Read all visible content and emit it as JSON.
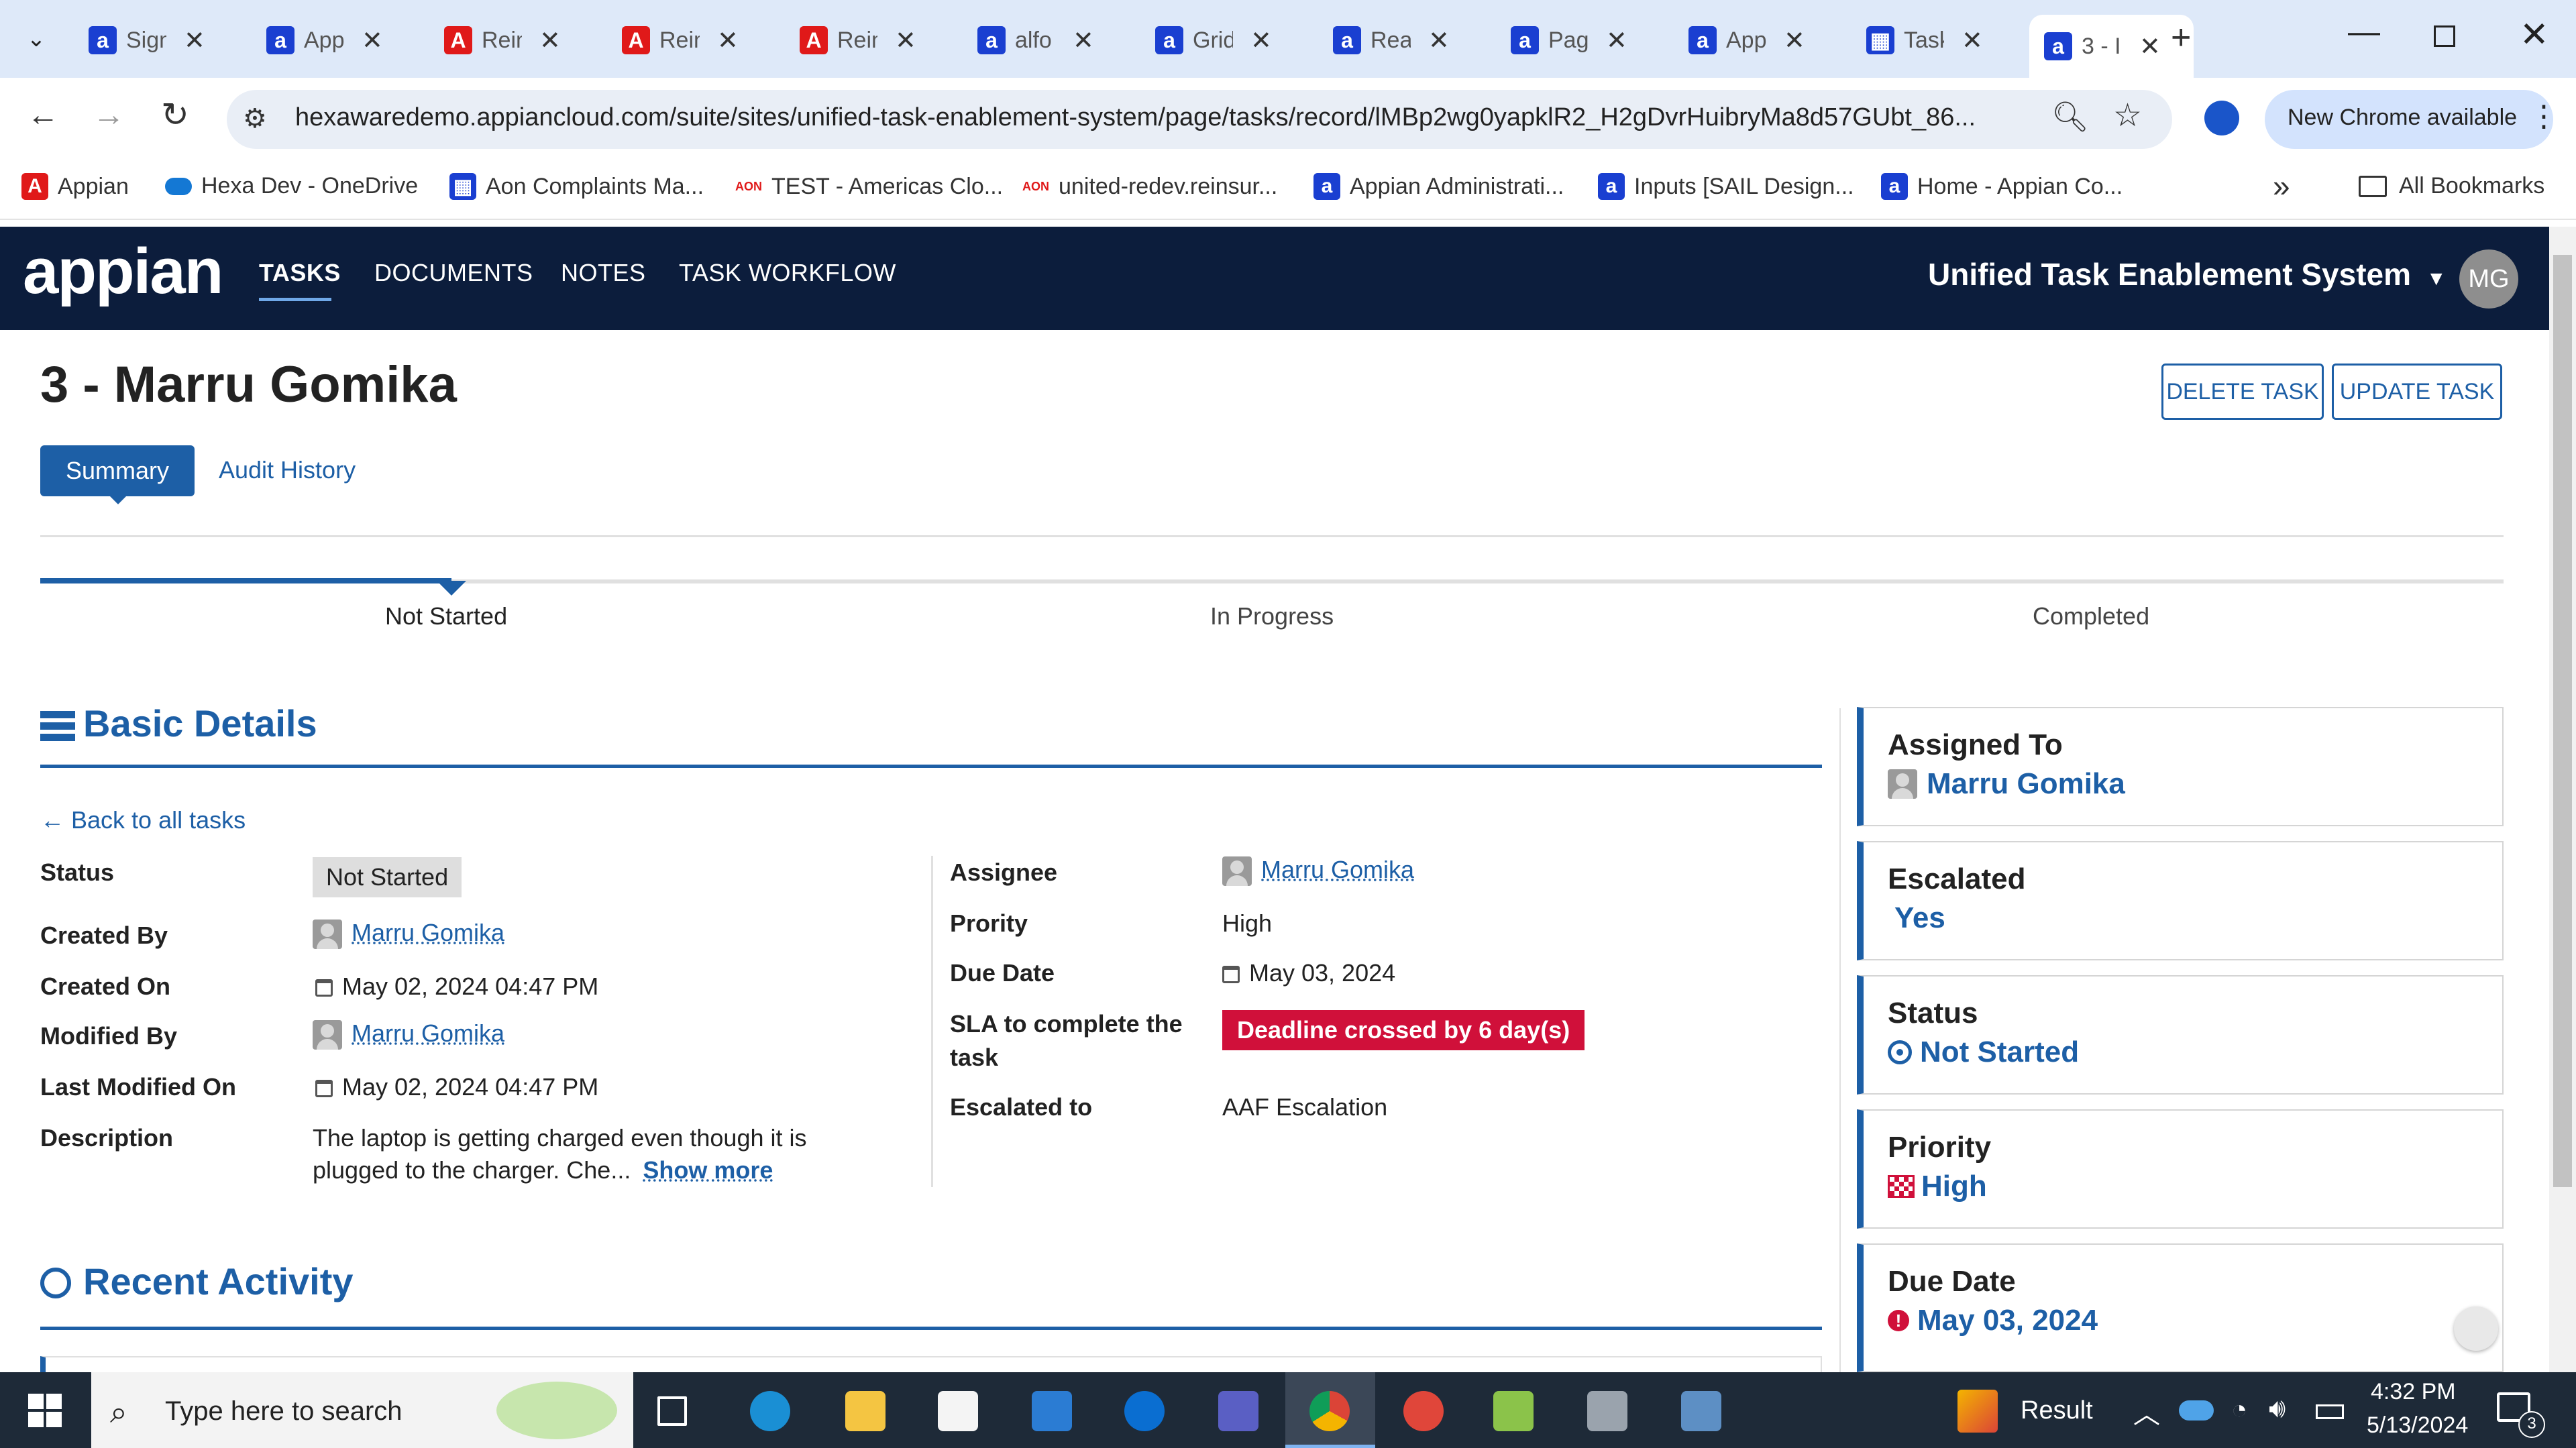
{
  "browser": {
    "tabs": [
      {
        "title": "Sign",
        "icon": "appian-icon",
        "color": "#1a3fd1"
      },
      {
        "title": "App",
        "icon": "appian-icon",
        "color": "#1a3fd1"
      },
      {
        "title": "Rein",
        "icon": "adobe-icon",
        "color": "#e01919"
      },
      {
        "title": "Rein",
        "icon": "adobe-icon",
        "color": "#e01919"
      },
      {
        "title": "Rein",
        "icon": "adobe-icon",
        "color": "#e01919"
      },
      {
        "title": "alfo",
        "icon": "appian-icon",
        "color": "#1a3fd1"
      },
      {
        "title": "Grid",
        "icon": "appian-icon",
        "color": "#1a3fd1"
      },
      {
        "title": "Rea",
        "icon": "appian-icon",
        "color": "#1a3fd1"
      },
      {
        "title": "Pag",
        "icon": "appian-icon",
        "color": "#1a3fd1"
      },
      {
        "title": "App",
        "icon": "appian-icon",
        "color": "#1a3fd1"
      },
      {
        "title": "Task",
        "icon": "grid-icon",
        "color": "#1a3fd1"
      },
      {
        "title": "3 - I",
        "icon": "appian-icon",
        "color": "#1a3fd1",
        "active": true
      }
    ],
    "url": "hexawaredemo.appiancloud.com/suite/sites/unified-task-enablement-system/page/tasks/record/lMBp2wg0yapklR2_H2gDvrHuibryMa8d57GUbt_86...",
    "new_chrome": "New Chrome available",
    "bookmarks": [
      {
        "label": "Appian",
        "icon": "adobe-icon",
        "color": "#e01919"
      },
      {
        "label": "Hexa Dev - OneDrive",
        "icon": "cloud-icon",
        "color": "#1478d4"
      },
      {
        "label": "Aon Complaints Ma...",
        "icon": "grid-icon",
        "color": "#1a3fd1"
      },
      {
        "label": "TEST - Americas Clo...",
        "icon": "aon-icon",
        "color": "#e01919"
      },
      {
        "label": "united-redev.reinsur...",
        "icon": "aon-icon",
        "color": "#e01919"
      },
      {
        "label": "Appian Administrati...",
        "icon": "appian-icon",
        "color": "#1a3fd1"
      },
      {
        "label": "Inputs [SAIL Design...",
        "icon": "appian-icon",
        "color": "#1a3fd1"
      },
      {
        "label": "Home - Appian Co...",
        "icon": "appian-icon",
        "color": "#1a3fd1"
      }
    ],
    "all_bookmarks": "All Bookmarks",
    "more": "»"
  },
  "app": {
    "logo": "appian",
    "nav": [
      "TASKS",
      "DOCUMENTS",
      "NOTES",
      "TASK WORKFLOW"
    ],
    "site_name": "Unified Task Enablement System",
    "user_initials": "MG"
  },
  "page": {
    "title": "3 - Marru Gomika",
    "delete_btn": "DELETE TASK",
    "update_btn": "UPDATE TASK",
    "tabs": [
      "Summary",
      "Audit History"
    ],
    "milestones": [
      "Not Started",
      "In Progress",
      "Completed"
    ],
    "milestone_progress": 0.167,
    "basic_details": "Basic Details",
    "back_link": "Back to all tasks",
    "left_fields": {
      "status_label": "Status",
      "status_value": "Not Started",
      "created_by_label": "Created By",
      "created_by_value": "Marru Gomika",
      "created_on_label": "Created On",
      "created_on_value": "May 02, 2024 04:47 PM",
      "modified_by_label": "Modified By",
      "modified_by_value": "Marru Gomika",
      "last_modified_label": "Last Modified On",
      "last_modified_value": "May 02, 2024 04:47 PM",
      "description_label": "Description",
      "description_line1": "The laptop is getting charged even though it is",
      "description_line2": "plugged to the charger. Che...",
      "show_more": "Show more"
    },
    "right_fields": {
      "assignee_label": "Assignee",
      "assignee_value": "Marru Gomika",
      "priority_label": "Prority",
      "priority_value": "High",
      "due_label": "Due Date",
      "due_value": "May 03, 2024",
      "sla_label_1": "SLA to complete the",
      "sla_label_2": "task",
      "sla_value": "Deadline crossed by 6 day(s)",
      "escalated_to_label": "Escalated to",
      "escalated_to_value": "AAF Escalation"
    },
    "recent_activity": "Recent Activity",
    "cards": [
      {
        "title": "Assigned To",
        "value": "Marru Gomika",
        "icon": "user-icon"
      },
      {
        "title": "Escalated",
        "value": "Yes",
        "icon": ""
      },
      {
        "title": "Status",
        "value": "Not Started",
        "icon": "status-circle-icon"
      },
      {
        "title": "Priority",
        "value": "High",
        "icon": "flag-icon"
      },
      {
        "title": "Due Date",
        "value": "May 03, 2024",
        "icon": "alert-icon"
      }
    ]
  },
  "taskbar": {
    "search_placeholder": "Type here to search",
    "result": "Result",
    "time": "4:32 PM",
    "date": "5/13/2024",
    "notif_count": "3"
  },
  "colors": {
    "accent": "#1d5fa6",
    "header": "#0c1d3c",
    "danger": "#d0103a"
  }
}
